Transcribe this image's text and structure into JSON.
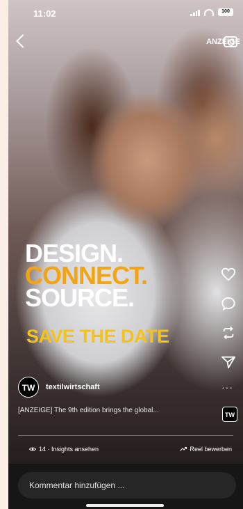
{
  "status_bar": {
    "time": "11:02",
    "battery": "100"
  },
  "top_bar": {
    "label": "ANZEIGE"
  },
  "ad": {
    "line1": "DESIGN.",
    "line2": "CONNECT.",
    "line3": "SOURCE.",
    "tagline": "SAVE THE DATE"
  },
  "post": {
    "avatar_text": "TW",
    "username": "textilwirtschaft",
    "caption": "[ANZEIGE] The 9th edition brings the global...",
    "badge_text": "TW"
  },
  "footer": {
    "insights": "14 · Insights ansehen",
    "apply": "Reel bewerben"
  },
  "comment_bar": {
    "placeholder": "Kommentar hinzufügen ..."
  },
  "icons": [
    "heart-icon",
    "comment-icon",
    "repost-icon",
    "send-icon",
    "more-icon"
  ],
  "colors": {
    "orange": "#f3a414",
    "yellow": "#f3c21b"
  }
}
